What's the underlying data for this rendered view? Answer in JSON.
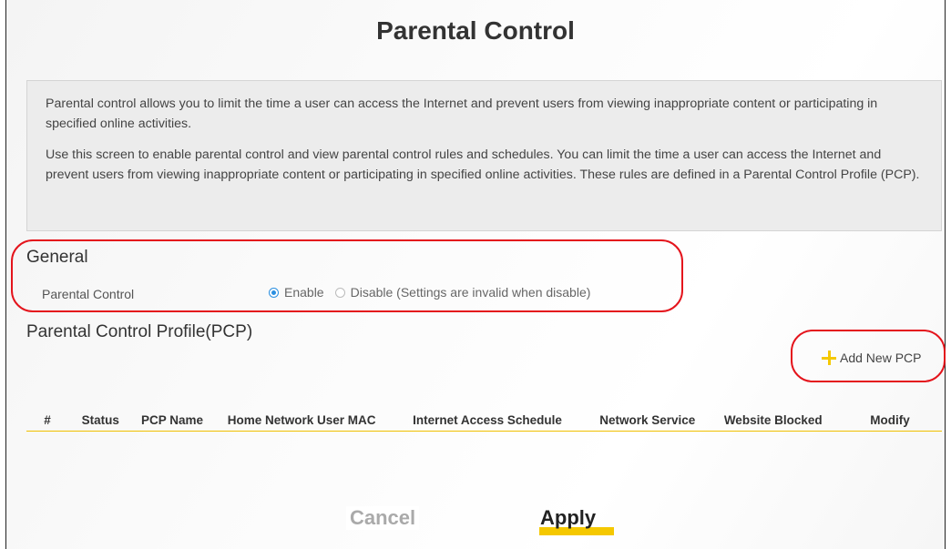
{
  "page": {
    "title": "Parental Control"
  },
  "description": {
    "paragraph1": "Parental control allows you to limit the time a user can access the Internet and prevent users from viewing inappropriate content or participating in specified online activities.",
    "paragraph2": "Use this screen to enable parental control and view parental control rules and schedules. You can limit the time a user can access the Internet and prevent users from viewing inappropriate content or participating in specified online activities. These rules are defined in a Parental Control Profile (PCP)."
  },
  "general": {
    "title": "General",
    "label": "Parental Control",
    "options": [
      {
        "label": "Enable",
        "selected": true
      },
      {
        "label": "Disable (Settings are invalid when disable)",
        "selected": false
      }
    ]
  },
  "pcp": {
    "title": "Parental Control Profile(PCP)",
    "add_label": "Add New PCP",
    "columns": [
      "#",
      "Status",
      "PCP Name",
      "Home Network User MAC",
      "Internet Access Schedule",
      "Network Service",
      "Website Blocked",
      "Modify"
    ],
    "rows": []
  },
  "buttons": {
    "cancel": "Cancel",
    "apply": "Apply"
  },
  "colors": {
    "highlight": "#e4141c",
    "accent": "#f5c800",
    "radio": "#2a8fe0"
  }
}
